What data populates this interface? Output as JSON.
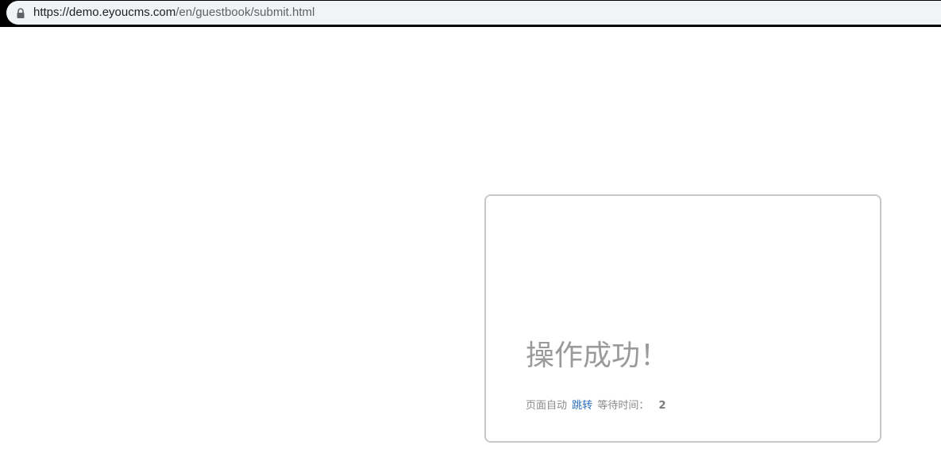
{
  "browser": {
    "url_host": "https://demo.eyoucms.com",
    "url_path": "/en/guestbook/submit.html",
    "lock_icon": "lock-icon"
  },
  "message": {
    "title": "操作成功！",
    "auto_text": "页面自动",
    "redirect_link": "跳转",
    "wait_text": "等待时间：",
    "countdown": "2"
  },
  "colors": {
    "title": "#9a9a9a",
    "link": "#2a6ebb",
    "border": "#c8c8c8"
  }
}
